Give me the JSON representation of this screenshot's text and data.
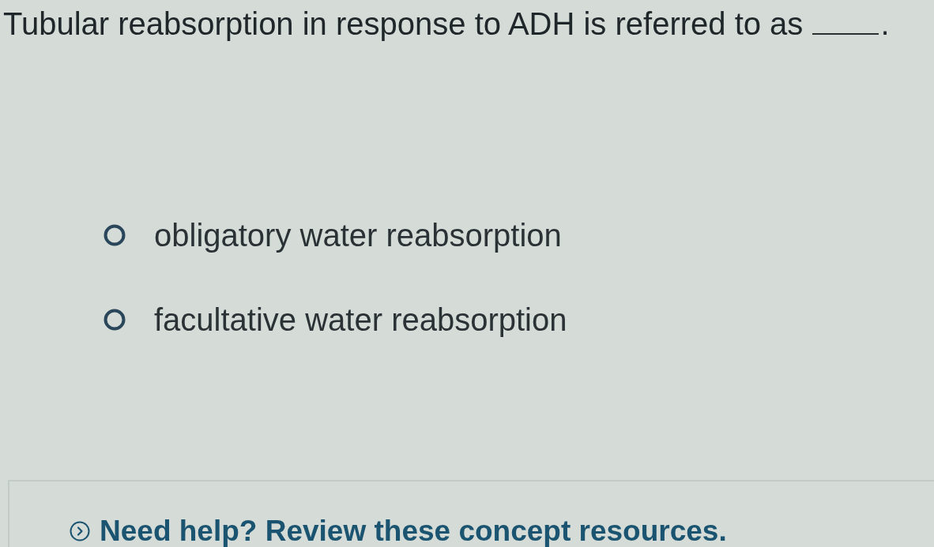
{
  "question": {
    "parts": [
      {
        "kind": "text",
        "text": "Tubular reabsorption in response to ADH is referred to as"
      },
      {
        "kind": "blank"
      },
      {
        "kind": "text",
        "text": "."
      }
    ]
  },
  "options": [
    {
      "label": "obligatory water reabsorption",
      "selected": false
    },
    {
      "label": "facultative water reabsorption",
      "selected": false
    }
  ],
  "help": {
    "label": "Need help? Review these concept resources.",
    "expanded": false
  }
}
